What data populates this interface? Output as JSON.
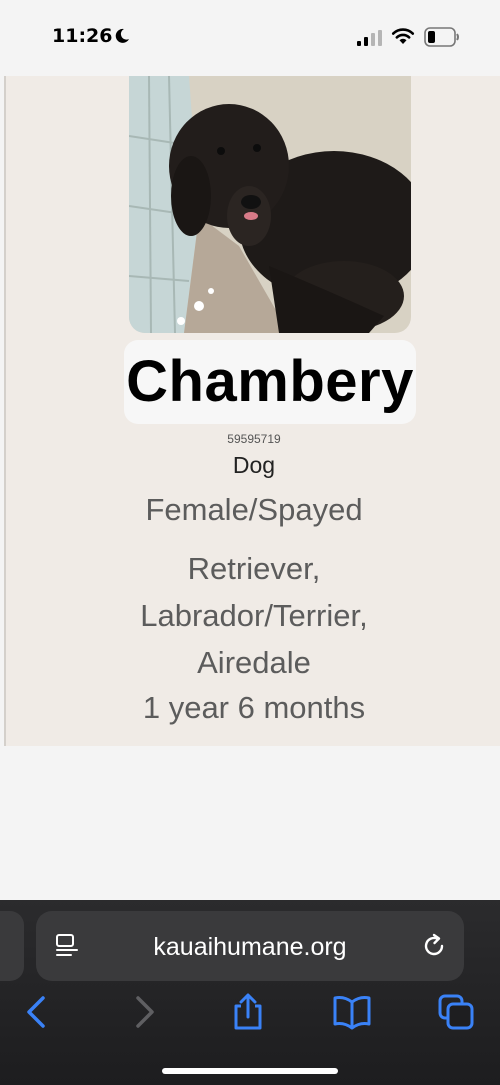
{
  "status_bar": {
    "time": "11:26"
  },
  "pet": {
    "name": "Chambery",
    "id": "59595719",
    "species": "Dog",
    "sex": "Female/Spayed",
    "breed_lines": [
      "Retriever,",
      "Labrador/Terrier,",
      "Airedale"
    ],
    "age": "1 year 6 months"
  },
  "browser": {
    "url": "kauaihumane.org"
  },
  "colors": {
    "accent": "#3a82f7",
    "card_bg": "#f0ebe6",
    "chrome_bg": "#2b2b2d"
  },
  "icons": {
    "status": [
      "moon-icon",
      "signal-icon",
      "wifi-icon",
      "battery-icon"
    ],
    "toolbar": [
      "back-icon",
      "forward-icon",
      "share-icon",
      "bookmarks-icon",
      "tabs-icon"
    ]
  }
}
